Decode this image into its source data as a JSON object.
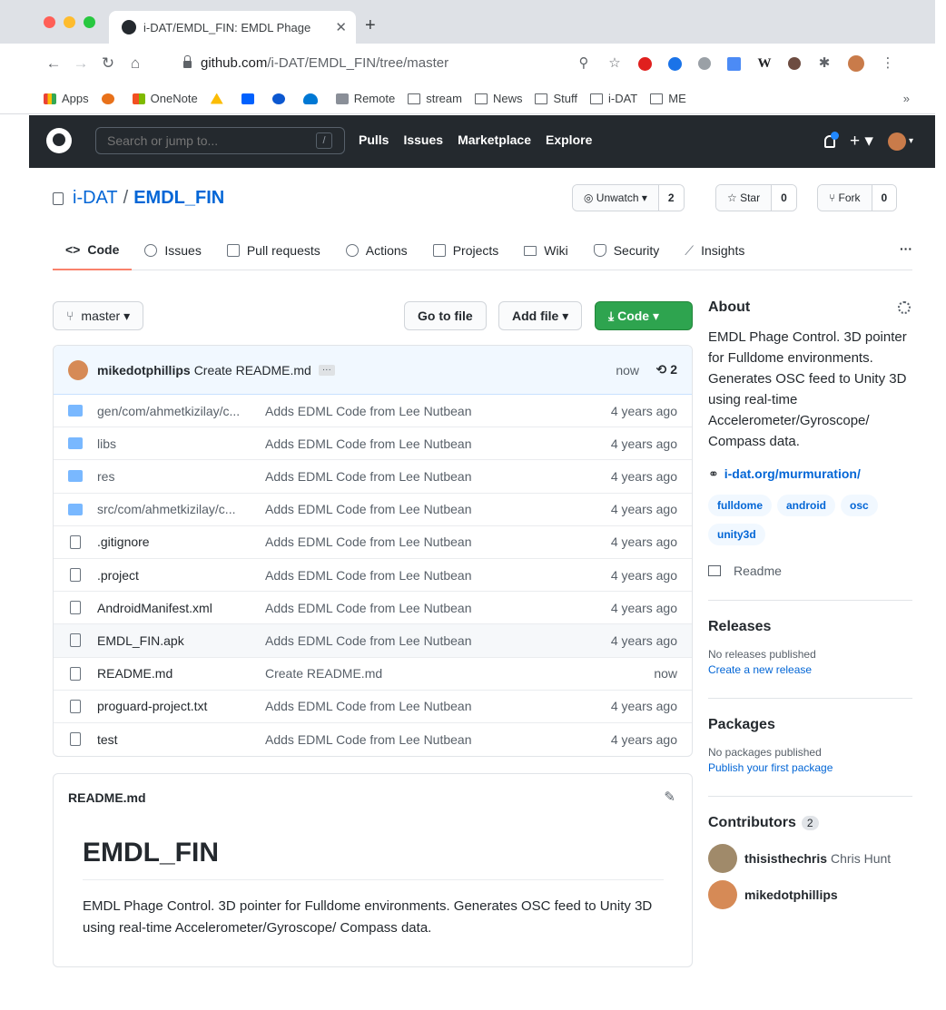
{
  "browser": {
    "tab_title": "i-DAT/EMDL_FIN: EMDL Phage",
    "url_host": "github.com",
    "url_path": "/i-DAT/EMDL_FIN/tree/master",
    "bookmarks": [
      {
        "label": "Apps",
        "icon": "apps-grid-icon"
      },
      {
        "label": "",
        "icon": "pinwheel-icon"
      },
      {
        "label": "OneNote",
        "icon": "windows-icon"
      },
      {
        "label": "",
        "icon": "drive-icon"
      },
      {
        "label": "",
        "icon": "dropbox-icon"
      },
      {
        "label": "",
        "icon": "blue-circle-icon"
      },
      {
        "label": "",
        "icon": "cloud-icon"
      },
      {
        "label": "Remote",
        "icon": "remote-icon"
      },
      {
        "label": "stream",
        "icon": "folder-icon"
      },
      {
        "label": "News",
        "icon": "folder-icon"
      },
      {
        "label": "Stuff",
        "icon": "folder-icon"
      },
      {
        "label": "i-DAT",
        "icon": "folder-icon"
      },
      {
        "label": "ME",
        "icon": "folder-icon"
      }
    ],
    "bookmarks_more": "»"
  },
  "header": {
    "search_placeholder": "Search or jump to...",
    "slash": "/",
    "nav": [
      "Pulls",
      "Issues",
      "Marketplace",
      "Explore"
    ],
    "plus": "+ ▾"
  },
  "repo": {
    "owner": "i-DAT",
    "separator": "/",
    "name": "EMDL_FIN",
    "watch_label": "◎ Unwatch ▾",
    "watch_count": "2",
    "star_label": "☆ Star",
    "star_count": "0",
    "fork_label": "⑂ Fork",
    "fork_count": "0"
  },
  "tabs": [
    {
      "label": "Code",
      "icon": "code-icon",
      "selected": true
    },
    {
      "label": "Issues",
      "icon": "issue-icon"
    },
    {
      "label": "Pull requests",
      "icon": "pull-request-icon"
    },
    {
      "label": "Actions",
      "icon": "play-icon"
    },
    {
      "label": "Projects",
      "icon": "project-icon"
    },
    {
      "label": "Wiki",
      "icon": "book-icon"
    },
    {
      "label": "Security",
      "icon": "shield-icon"
    },
    {
      "label": "Insights",
      "icon": "graph-icon"
    }
  ],
  "tabs_more": "···",
  "file_toolbar": {
    "branch": "master ▾",
    "go_to_file": "Go to file",
    "add_file": "Add file ▾",
    "code": "⤓  Code ▾"
  },
  "commit": {
    "user": "mikedotphillips",
    "message": "Create README.md",
    "ellipsis": "···",
    "time": "now",
    "history": "⟲ 2"
  },
  "files": [
    {
      "name": "gen/com/ahmetkizilay/c...",
      "type": "dir",
      "message": "Adds EDML Code from Lee Nutbean",
      "age": "4 years ago"
    },
    {
      "name": "libs",
      "type": "dir",
      "message": "Adds EDML Code from Lee Nutbean",
      "age": "4 years ago"
    },
    {
      "name": "res",
      "type": "dir",
      "message": "Adds EDML Code from Lee Nutbean",
      "age": "4 years ago"
    },
    {
      "name": "src/com/ahmetkizilay/c...",
      "type": "dir",
      "message": "Adds EDML Code from Lee Nutbean",
      "age": "4 years ago"
    },
    {
      "name": ".gitignore",
      "type": "file",
      "message": "Adds EDML Code from Lee Nutbean",
      "age": "4 years ago"
    },
    {
      "name": ".project",
      "type": "file",
      "message": "Adds EDML Code from Lee Nutbean",
      "age": "4 years ago"
    },
    {
      "name": "AndroidManifest.xml",
      "type": "file",
      "message": "Adds EDML Code from Lee Nutbean",
      "age": "4 years ago"
    },
    {
      "name": "EMDL_FIN.apk",
      "type": "file",
      "message": "Adds EDML Code from Lee Nutbean",
      "age": "4 years ago",
      "highlighted": true
    },
    {
      "name": "README.md",
      "type": "file",
      "message": "Create README.md",
      "age": "now"
    },
    {
      "name": "proguard-project.txt",
      "type": "file",
      "message": "Adds EDML Code from Lee Nutbean",
      "age": "4 years ago"
    },
    {
      "name": "test",
      "type": "file",
      "message": "Adds EDML Code from Lee Nutbean",
      "age": "4 years ago"
    }
  ],
  "readme": {
    "filename": "README.md",
    "heading": "EMDL_FIN",
    "body": "EMDL Phage Control. 3D pointer for Fulldome environments. Generates OSC feed to Unity 3D using real-time Accelerometer/Gyroscope/ Compass data."
  },
  "sidebar": {
    "about_title": "About",
    "description": "EMDL Phage Control. 3D pointer for Fulldome environments. Generates OSC feed to Unity 3D using real-time Accelerometer/Gyroscope/ Compass data.",
    "website": "i-dat.org/murmuration/",
    "topics": [
      "fulldome",
      "android",
      "osc",
      "unity3d"
    ],
    "readme_label": "Readme",
    "releases_title": "Releases",
    "releases_none": "No releases published",
    "releases_create": "Create a new release",
    "packages_title": "Packages",
    "packages_none": "No packages published",
    "packages_publish": "Publish your first package",
    "contributors_title": "Contributors",
    "contributors_count": "2",
    "contributors": [
      {
        "login": "thisisthechris",
        "name": "Chris Hunt"
      },
      {
        "login": "mikedotphillips",
        "name": ""
      }
    ]
  },
  "colors": {
    "link": "#0366d6",
    "header_bg": "#24292e",
    "code_button": "#2ea44f",
    "selected_tab_underline": "#f9826c"
  }
}
